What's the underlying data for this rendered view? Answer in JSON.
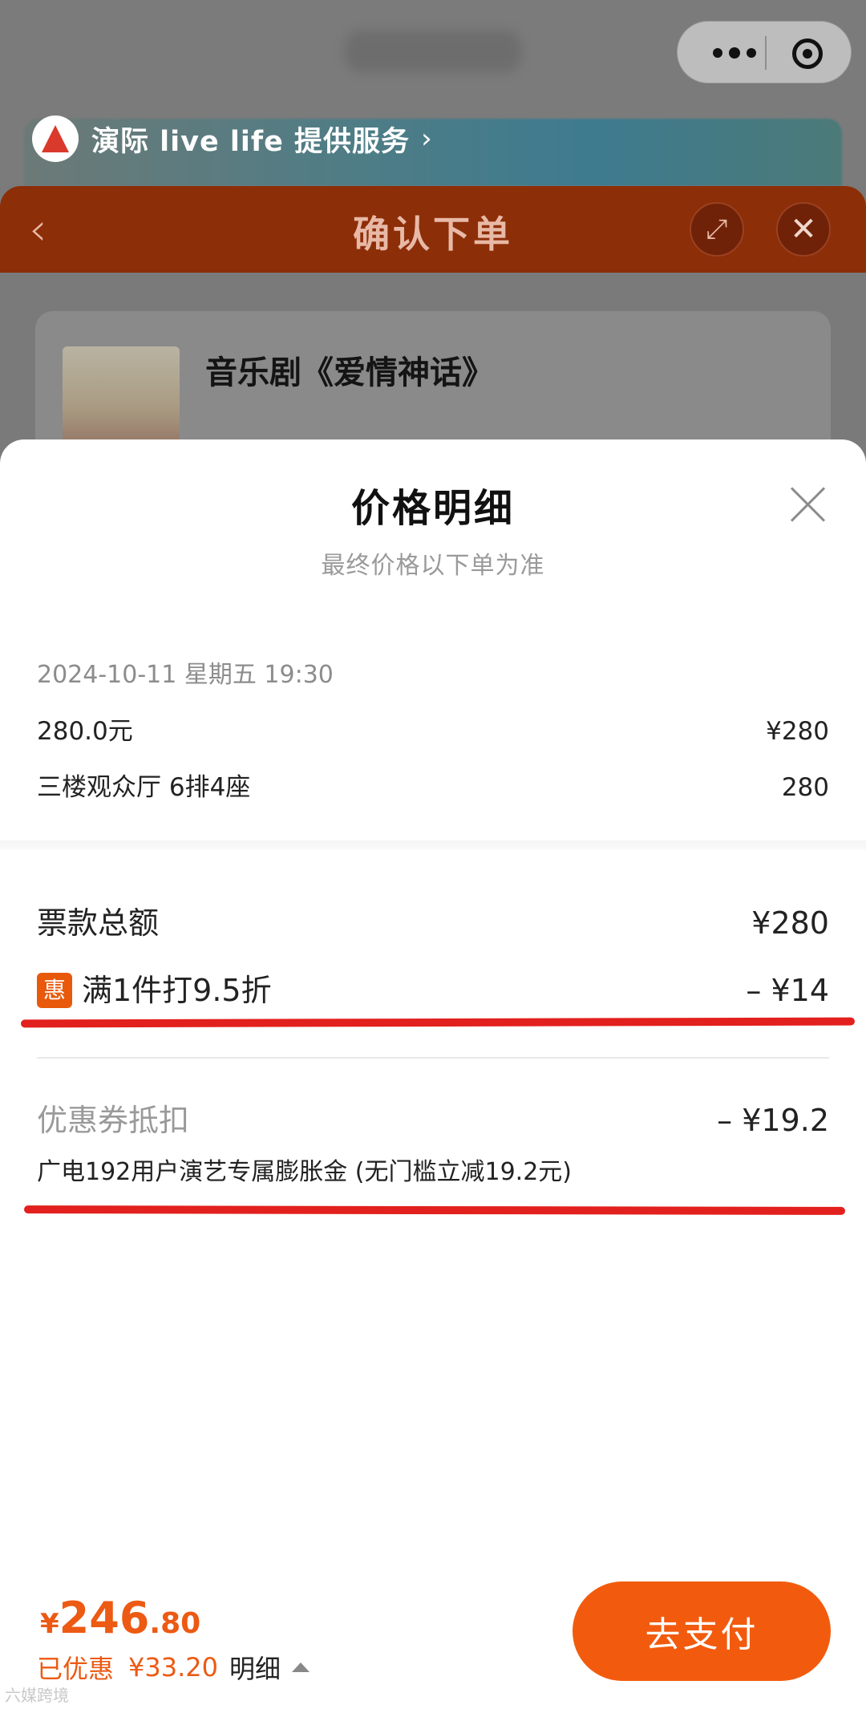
{
  "provider": {
    "text": "演际 live life 提供服务",
    "chevron": "›"
  },
  "order_header": {
    "back": "‹",
    "title": "确认下单",
    "expand_icon": "⤢",
    "close_icon": "✕"
  },
  "show": {
    "title": "音乐剧《爱情神话》"
  },
  "sheet": {
    "title": "价格明细",
    "subtitle": "最终价格以下单为准",
    "session": "2024-10-11 星期五 19:30",
    "items": [
      {
        "label": "280.0元",
        "value": "¥280"
      },
      {
        "label": "三楼观众厅 6排4座",
        "value": "280"
      }
    ],
    "ticket_total": {
      "label": "票款总额",
      "value": "¥280"
    },
    "discount": {
      "tag": "惠",
      "label": "满1件打9.5折",
      "value": "– ¥14"
    },
    "coupon": {
      "label": "优惠券抵扣",
      "value": "– ¥19.2",
      "desc": "广电192用户演艺专属膨胀金 (无门槛立减19.2元)"
    }
  },
  "footer": {
    "currency": "¥",
    "total_int": "246",
    "total_dec": ".80",
    "saved_label": "已优惠",
    "saved_amount": "¥33.20",
    "detail_label": "明细",
    "pay_button": "去支付"
  },
  "watermark": "六媒跨境",
  "colors": {
    "accent": "#f25b0e",
    "header": "#8c2e08",
    "annotation": "#e2201d"
  }
}
